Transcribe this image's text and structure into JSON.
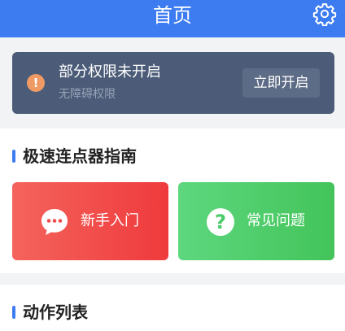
{
  "header": {
    "title": "首页",
    "settings_icon": "gear-icon",
    "bg_color": "#3d7cf0"
  },
  "permission_banner": {
    "icon": "exclamation-circle-icon",
    "title": "部分权限未开启",
    "subtitle": "无障碍权限",
    "button_label": "立即开启"
  },
  "guide_section": {
    "title": "极速连点器指南",
    "tiles": [
      {
        "label": "新手入门",
        "icon": "chat-bubble-icon",
        "color": "#f04a4a"
      },
      {
        "label": "常见问题",
        "icon": "question-circle-icon",
        "color": "#4ccb69"
      }
    ]
  },
  "actions_section": {
    "title": "动作列表"
  }
}
